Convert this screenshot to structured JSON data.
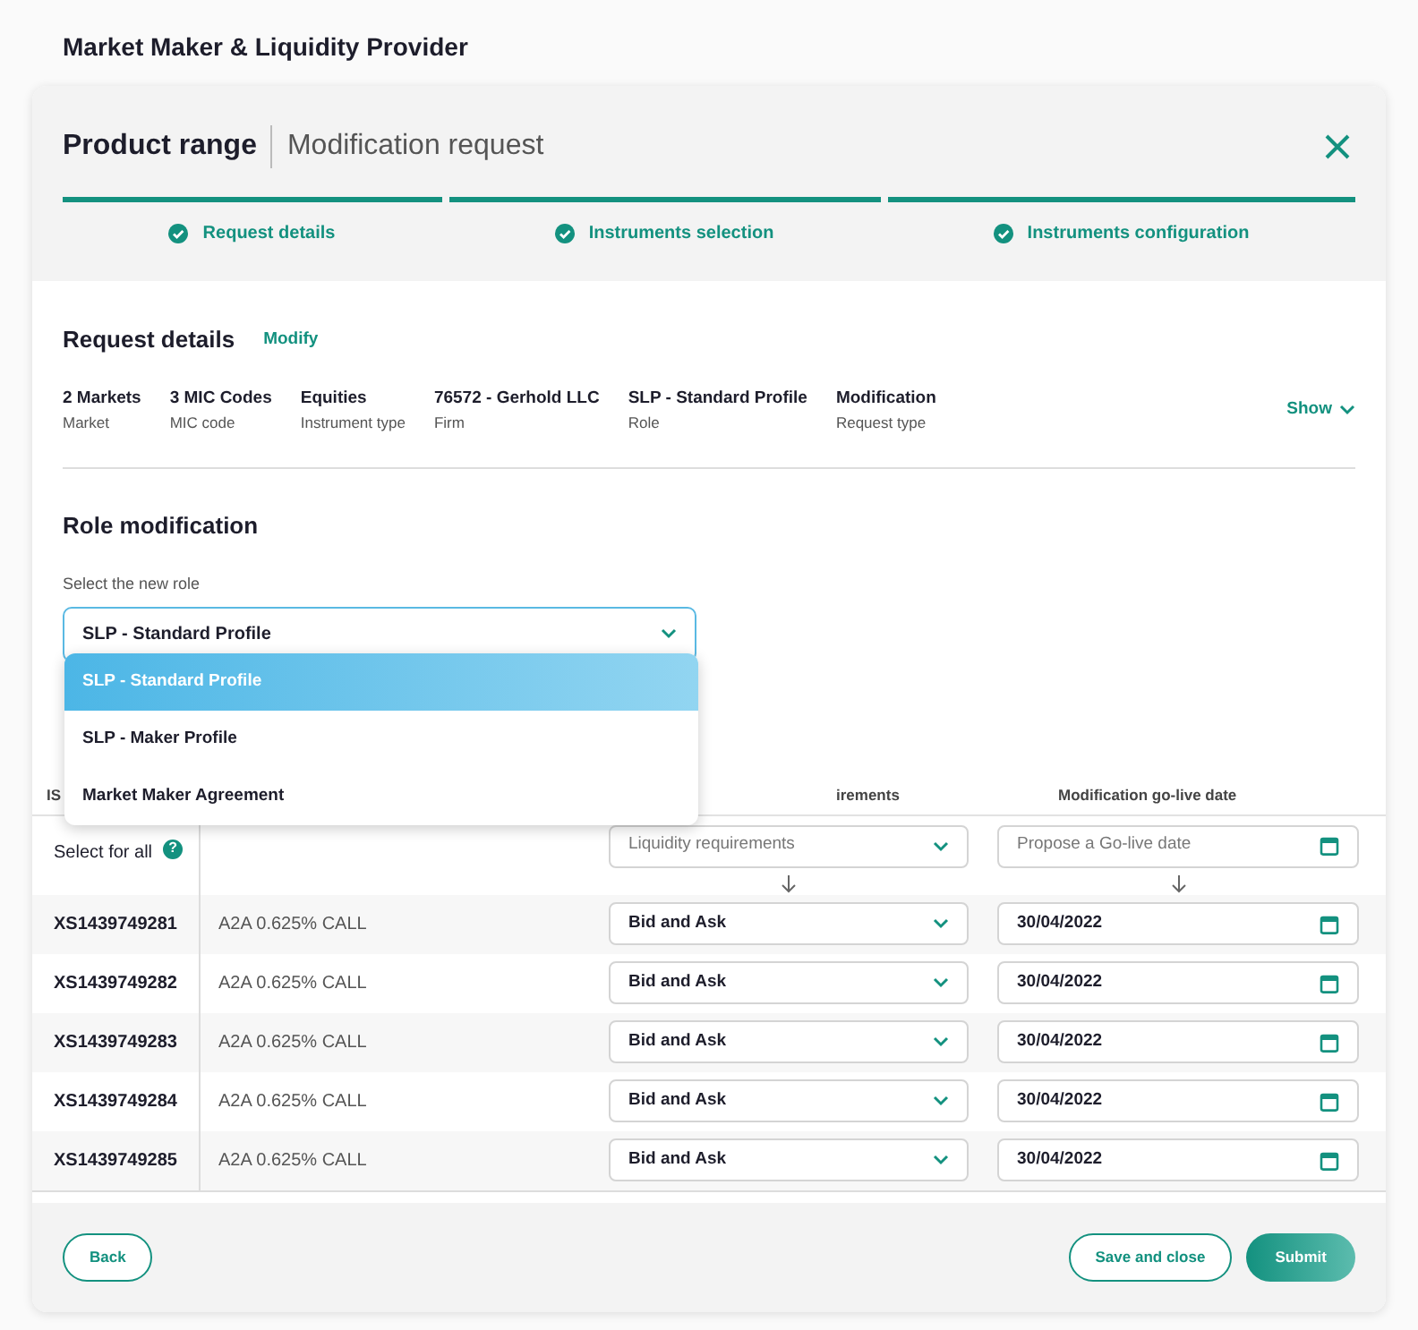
{
  "app_title": "Market Maker & Liquidity Provider",
  "dialog": {
    "title": "Product range",
    "subtitle": "Modification request"
  },
  "steps": [
    {
      "label": "Request details",
      "done": true
    },
    {
      "label": "Instruments selection",
      "done": true
    },
    {
      "label": "Instruments configuration",
      "done": true
    }
  ],
  "request_details": {
    "title": "Request details",
    "modify_link": "Modify",
    "show_toggle": "Show",
    "fields": [
      {
        "value": "2 Markets",
        "label": "Market"
      },
      {
        "value": "3 MIC Codes",
        "label": "MIC code"
      },
      {
        "value": "Equities",
        "label": "Instrument type"
      },
      {
        "value": "76572 - Gerhold LLC",
        "label": "Firm"
      },
      {
        "value": "SLP - Standard Profile",
        "label": "Role"
      },
      {
        "value": "Modification",
        "label": "Request type"
      }
    ]
  },
  "role_modification": {
    "title": "Role modification",
    "field_label": "Select the new role",
    "value": "SLP - Standard Profile",
    "expanded": true,
    "options": [
      {
        "label": "SLP - Standard Profile",
        "selected": true
      },
      {
        "label": "SLP - Maker Profile",
        "selected": false
      },
      {
        "label": "Market Maker Agreement",
        "selected": false
      }
    ]
  },
  "table": {
    "column_1": "IS",
    "column_3": "irements",
    "column_4": "Modification go-live date",
    "select_all": {
      "label": "Select for all",
      "help_glyph": "?",
      "liquidity_placeholder": "Liquidity requirements",
      "date_placeholder": "Propose a Go-live date"
    },
    "rows": [
      {
        "isin": "XS1439749281",
        "instrument": "A2A 0.625% CALL",
        "liquidity": "Bid and Ask",
        "date": "30/04/2022"
      },
      {
        "isin": "XS1439749282",
        "instrument": "A2A 0.625% CALL",
        "liquidity": "Bid and Ask",
        "date": "30/04/2022"
      },
      {
        "isin": "XS1439749283",
        "instrument": "A2A 0.625% CALL",
        "liquidity": "Bid and Ask",
        "date": "30/04/2022"
      },
      {
        "isin": "XS1439749284",
        "instrument": "A2A 0.625% CALL",
        "liquidity": "Bid and Ask",
        "date": "30/04/2022"
      },
      {
        "isin": "XS1439749285",
        "instrument": "A2A 0.625% CALL",
        "liquidity": "Bid and Ask",
        "date": "30/04/2022"
      }
    ]
  },
  "buttons": {
    "back": "Back",
    "save": "Save and close",
    "submit": "Submit"
  }
}
